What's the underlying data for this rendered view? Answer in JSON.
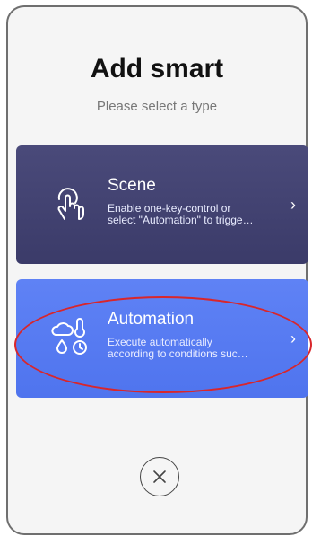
{
  "dialog": {
    "title": "Add smart",
    "subtitle": "Please select a type"
  },
  "cards": [
    {
      "title": "Scene",
      "description_lines": [
        "Enable one-key-control or",
        "select \"Automation\" to trigge…"
      ],
      "icon": "tap-hand-icon",
      "chevron": "›",
      "background": "#3f3f6e"
    },
    {
      "title": "Automation",
      "description_lines": [
        "Execute automatically",
        "according to conditions suc…"
      ],
      "icon": "weather-clock-icon",
      "chevron": "›",
      "background": "#5679f0"
    }
  ],
  "close": {
    "icon": "close-icon",
    "symbol": "×"
  },
  "annotation": {
    "color": "#d9262b",
    "target": "automation-card"
  }
}
